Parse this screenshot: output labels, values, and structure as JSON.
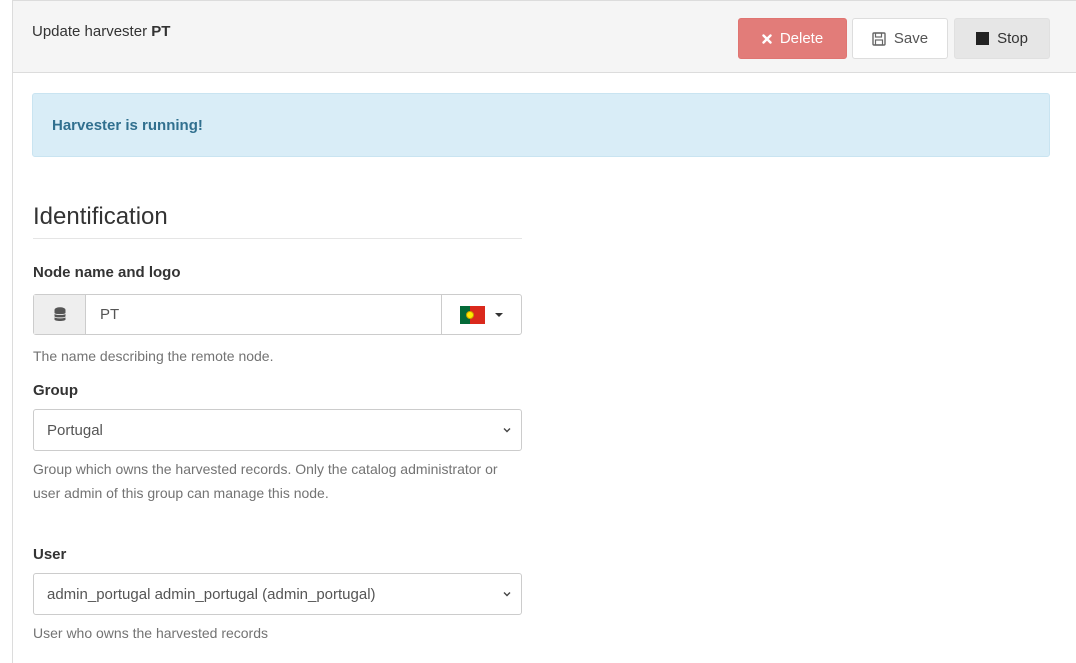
{
  "header": {
    "title_prefix": "Update harvester",
    "title_name": "PT",
    "buttons": {
      "delete_label": "Delete",
      "save_label": "Save",
      "stop_label": "Stop"
    }
  },
  "alert": {
    "text": "Harvester is running!"
  },
  "section": {
    "title": "Identification"
  },
  "node": {
    "label": "Node name and logo",
    "value": "PT",
    "help": "The name describing the remote node.",
    "addon_icon": "database-icon",
    "logo_icon": "portugal-flag-icon"
  },
  "group": {
    "label": "Group",
    "selected": "Portugal",
    "help": "Group which owns the harvested records. Only the catalog administrator or user admin of this group can manage this node."
  },
  "user": {
    "label": "User",
    "selected": "admin_portugal admin_portugal (admin_portugal)",
    "help": "User who owns the harvested records"
  },
  "colors": {
    "danger": "#e27c79",
    "info_bg": "#d9edf7",
    "info_text": "#31708f"
  }
}
